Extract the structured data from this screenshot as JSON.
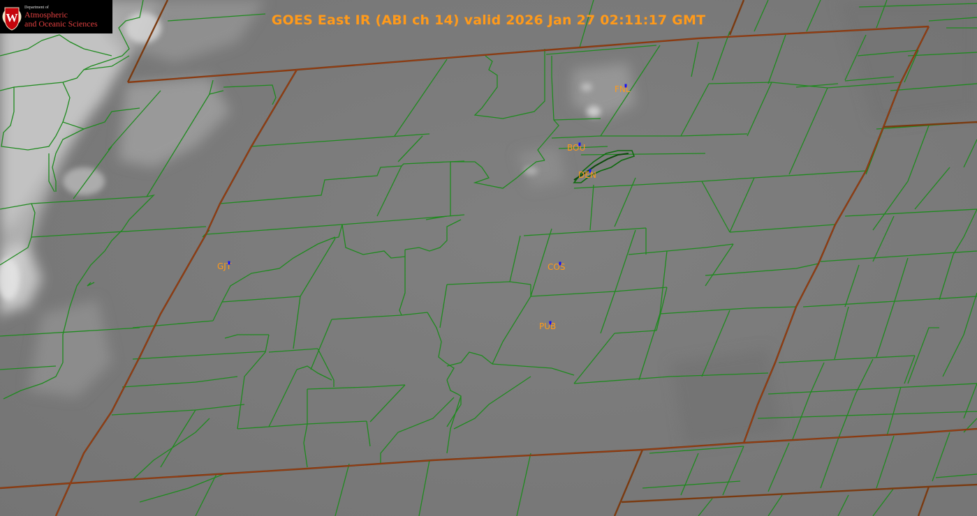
{
  "title": "GOES East IR (ABI ch 14) valid 2026 Jan 27 02:11:17 GMT",
  "logo": {
    "dept": "Department of",
    "line1": "Atmospheric",
    "line2": "and Oceanic Sciences",
    "emblem_letter": "W",
    "emblem_color": "#c5050c"
  },
  "colors": {
    "county_lines": "#1e8a1e",
    "state_lines": "#7a3a10",
    "station_labels": "#ff9a1a",
    "station_markers": "#1010ff",
    "cloud_tone": "#c8c8c8"
  },
  "stations": [
    {
      "id": "FNL",
      "label": "FNL"
    },
    {
      "id": "BOU",
      "label": "BOU"
    },
    {
      "id": "DEN",
      "label": "DEN"
    },
    {
      "id": "GJT",
      "label": "GJT"
    },
    {
      "id": "COS",
      "label": "COS"
    },
    {
      "id": "PUB",
      "label": "PUB"
    }
  ]
}
